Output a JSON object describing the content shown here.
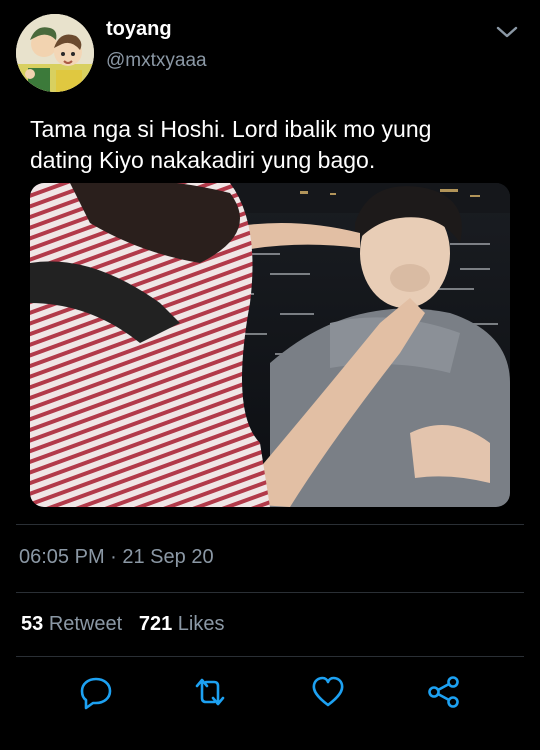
{
  "tweet": {
    "display_name": "toyang",
    "handle": "@mxtxyaaa",
    "text_line1": "Tama nga si Hoshi. Lord ibalik mo yung",
    "text_line2": "dating Kiyo nakakadiri yung bago.",
    "timestamp": "06:05 PM · 21 Sep 20"
  },
  "stats": {
    "retweet_count": "53",
    "retweet_label": "Retweet",
    "like_count": "721",
    "like_label": "Likes"
  },
  "icons": {
    "menu": "chevron-down-icon",
    "reply": "reply-icon",
    "retweet": "retweet-icon",
    "like": "heart-icon",
    "share": "share-icon"
  },
  "colors": {
    "background": "#000000",
    "text": "#ffffff",
    "secondary_text": "#8b98a5",
    "icon": "#1da1f2"
  }
}
